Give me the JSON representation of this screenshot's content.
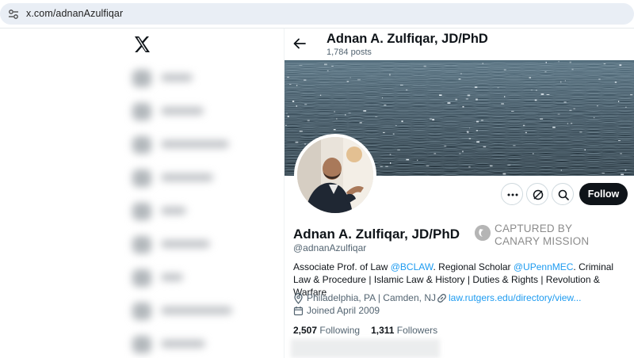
{
  "browser": {
    "url": "x.com/adnanAzulfiqar"
  },
  "header": {
    "name": "Adnan A. Zulfiqar, JD/PhD",
    "posts": "1,784 posts"
  },
  "profile": {
    "name": "Adnan A. Zulfiqar, JD/PhD",
    "handle": "@adnanAzulfiqar",
    "bio": {
      "p1": "Associate Prof. of Law ",
      "link1": "@BCLAW",
      "p2": ". Regional Scholar ",
      "link2": "@UPennMEC",
      "p3": ". Criminal Law & Procedure | Islamic Law & History | Duties & Rights | Revolution & Warfare"
    },
    "location": "Philadelphia, PA | Camden, NJ",
    "website": "law.rutgers.edu/directory/view...",
    "joined": "Joined April 2009",
    "following_count": "2,507",
    "following_label": "Following",
    "followers_count": "1,311",
    "followers_label": "Followers"
  },
  "actions": {
    "follow_label": "Follow",
    "more_icon": "more-icon",
    "grok_icon": "grok-icon",
    "search_icon": "search-icon"
  },
  "watermark": {
    "line1": "CAPTURED BY",
    "line2": "CANARY MISSION"
  },
  "colors": {
    "accent": "#1d9bf0",
    "text": "#0f1419",
    "muted": "#536471",
    "follow_bg": "#0f1419"
  }
}
